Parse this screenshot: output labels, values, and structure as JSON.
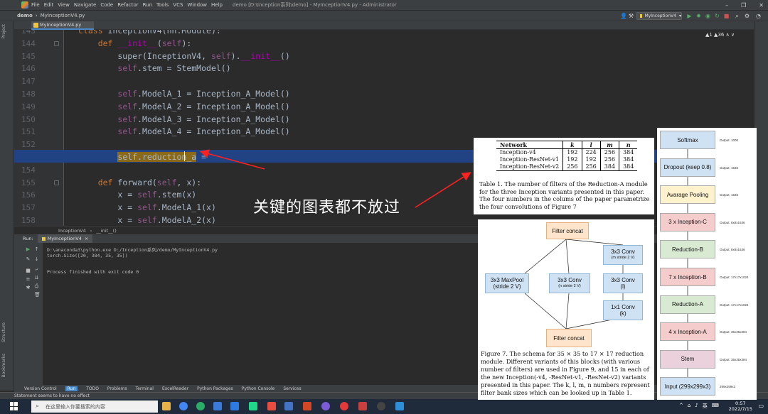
{
  "titlebar": {
    "menu": [
      "File",
      "Edit",
      "View",
      "Navigate",
      "Code",
      "Refactor",
      "Run",
      "Tools",
      "VCS",
      "Window",
      "Help"
    ],
    "window_title": "demo [D:\\Inception系列\\demo] - MyInceptionV4.py - Administrator"
  },
  "navbar": {
    "project": "demo",
    "file": "MyInceptionV4.py",
    "run_config": "MyInceptionV4"
  },
  "editor": {
    "tab_label": "MyInceptionV4.py",
    "warnings": "▲1 ▲36 ∧ ∨",
    "lines": [
      {
        "n": "143",
        "code": "class InceptionV4(nn.Module):"
      },
      {
        "n": "144",
        "code": "    def __init__(self):"
      },
      {
        "n": "145",
        "code": "        super(InceptionV4, self).__init__()"
      },
      {
        "n": "146",
        "code": "        self.stem = StemModel()"
      },
      {
        "n": "147",
        "code": ""
      },
      {
        "n": "148",
        "code": "        self.ModelA_1 = Inception_A_Model()"
      },
      {
        "n": "149",
        "code": "        self.ModelA_2 = Inception_A_Model()"
      },
      {
        "n": "150",
        "code": "        self.ModelA_3 = Inception_A_Model()"
      },
      {
        "n": "151",
        "code": "        self.ModelA_4 = Inception_A_Model()"
      },
      {
        "n": "152",
        "code": ""
      },
      {
        "n": "153",
        "code": "        self.reduction_a = "
      },
      {
        "n": "154",
        "code": ""
      },
      {
        "n": "155",
        "code": "    def forward(self, x):"
      },
      {
        "n": "156",
        "code": "        x = self.stem(x)"
      },
      {
        "n": "157",
        "code": "        x = self.ModelA_1(x)"
      },
      {
        "n": "158",
        "code": "        x = self.ModelA_2(x)"
      }
    ],
    "breadcrumb": [
      "InceptionV4",
      "__init__()"
    ]
  },
  "run": {
    "label": "Run:",
    "tab": "MyInceptionV4",
    "output": [
      "D:\\anaconda3\\python.exe D:/Inception系列/demo/MyInceptionV4.py",
      "torch.Size([20, 384, 35, 35])",
      "",
      "Process finished with exit code 0"
    ]
  },
  "tooltabs": [
    "Version Control",
    "Run",
    "TODO",
    "Problems",
    "Terminal",
    "ExcelReader",
    "Python Packages",
    "Python Console",
    "Services"
  ],
  "side_labels": {
    "project": "Project",
    "structure": "Structure",
    "bookmarks": "Bookmarks"
  },
  "status": "Statement seems to have no effect",
  "overlay_caption": "关键的图表都不放过",
  "table1": {
    "headers": [
      "Network",
      "k",
      "l",
      "m",
      "n"
    ],
    "rows": [
      [
        "Inception-v4",
        "192",
        "224",
        "256",
        "384"
      ],
      [
        "Inception-ResNet-v1",
        "192",
        "192",
        "256",
        "384"
      ],
      [
        "Inception-ResNet-v2",
        "256",
        "256",
        "384",
        "384"
      ]
    ],
    "caption": "Table 1. The number of filters of the Reduction-A module for the three Inception variants presented in this paper. The four numbers in the colums of the paper parametrize the four convolutions of Figure 7"
  },
  "figure7": {
    "filter_concat_top": "Filter concat",
    "filter_concat_bottom": "Filter concat",
    "maxpool": "3x3 MaxPool",
    "maxpool_sub": "(stride 2 V)",
    "conv_mid": "3x3 Conv",
    "conv_mid_sub": "(n stride 2 V)",
    "conv_top_right": "3x3 Conv",
    "conv_top_right_sub": "(m stride 2 V)",
    "conv_l": "3x3 Conv",
    "conv_l_sub": "(l)",
    "conv_k": "1x1 Conv",
    "conv_k_sub": "(k)",
    "caption": "Figure 7. The schema for 35 × 35 to 17 × 17 reduction module. Different variants of this blocks (with various number of filters) are used in Figure 9, and 15 in each of the new Inception(-v4, -ResNet-v1, -ResNet-v2) variants presented in this paper. The k, l, m, n numbers represent filter bank sizes which can be looked up in Table 1."
  },
  "architecture": [
    {
      "label": "Softmax",
      "out": "Output: 1000",
      "color": "#cfe2f3"
    },
    {
      "label": "Dropout (keep 0.8)",
      "out": "Output: 1536",
      "color": "#cfe2f3"
    },
    {
      "label": "Avarage Pooling",
      "out": "Output: 1536",
      "color": "#fff2cc"
    },
    {
      "label": "3 x Inception-C",
      "out": "Output: 8x8x1536",
      "color": "#f4cccc"
    },
    {
      "label": "Reduction-B",
      "out": "Output: 8x8x1536",
      "color": "#d9ead3"
    },
    {
      "label": "7 x Inception-B",
      "out": "Output: 17x17x1024",
      "color": "#f4cccc"
    },
    {
      "label": "Reduction-A",
      "out": "Output: 17x17x1024",
      "color": "#d9ead3"
    },
    {
      "label": "4 x Inception-A",
      "out": "Output: 35x35x384",
      "color": "#f4cccc"
    },
    {
      "label": "Stem",
      "out": "Output: 35x35x384",
      "color": "#ead1dc"
    },
    {
      "label": "Input (299x299x3)",
      "out": "299x299x3",
      "color": "#cfe2f3"
    }
  ],
  "taskbar": {
    "search_placeholder": "在这里输入你要搜索的内容",
    "time": "0:57",
    "date": "2022/7/15",
    "ime": "英"
  },
  "colors": {
    "accent": "#4a88c7",
    "selection": "#214283",
    "keyword": "#cc7832"
  }
}
